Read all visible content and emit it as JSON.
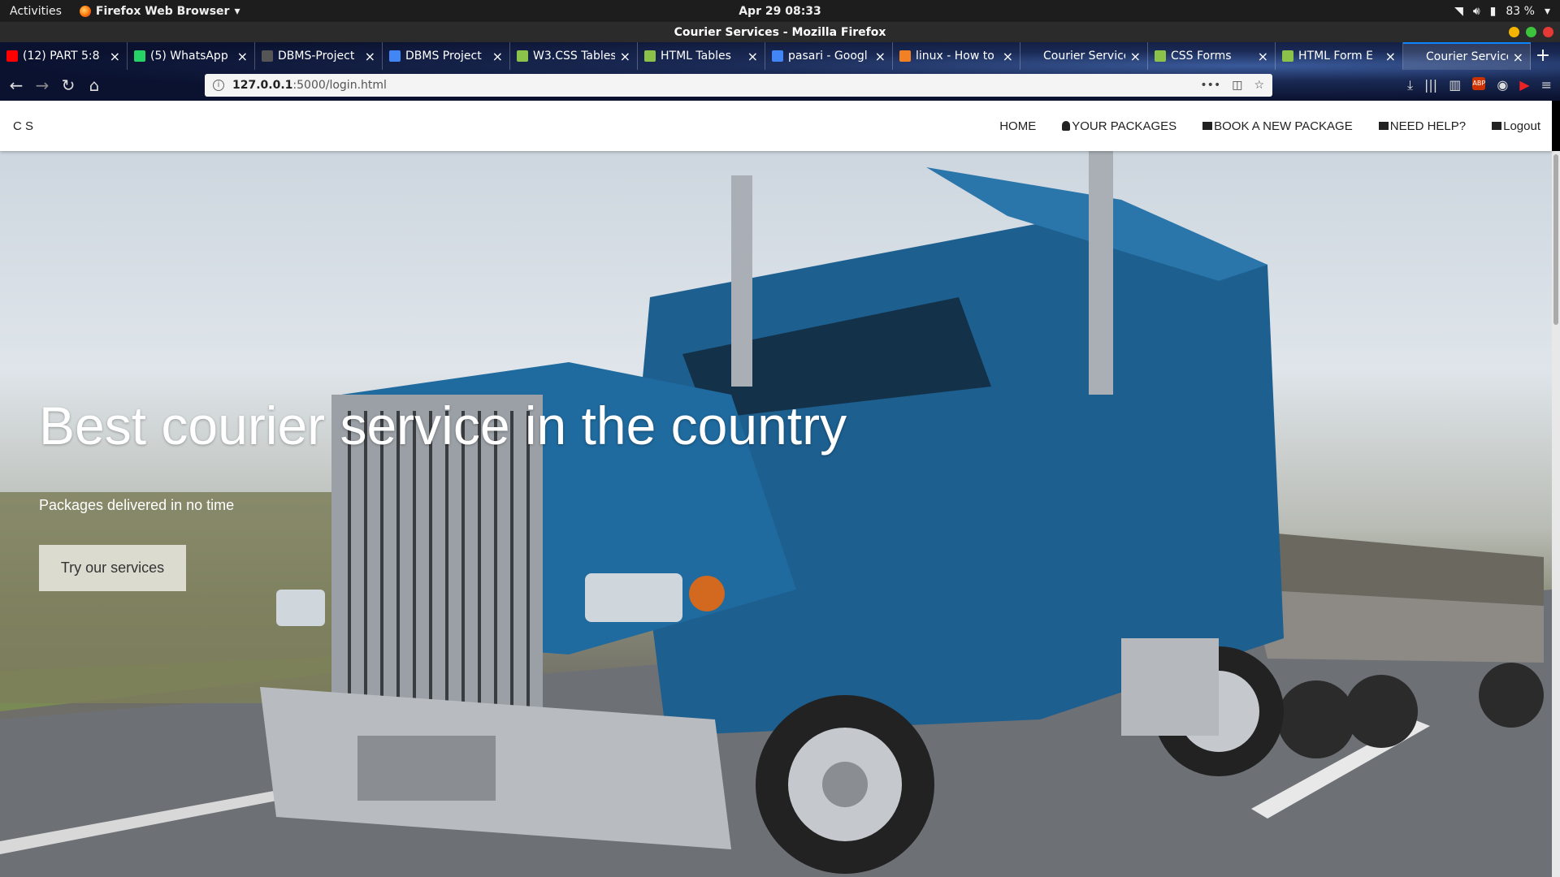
{
  "system": {
    "activities": "Activities",
    "app_menu": "Firefox Web Browser",
    "clock": "Apr 29  08:33",
    "battery": "83 %"
  },
  "window": {
    "title": "Courier Services - Mozilla Firefox"
  },
  "tabs": [
    {
      "label": "(12) PART 5:8",
      "favicon_color": "#ff0000"
    },
    {
      "label": "(5) WhatsApp",
      "favicon_color": "#25d366"
    },
    {
      "label": "DBMS-Project",
      "favicon_color": "#555555"
    },
    {
      "label": "DBMS Project",
      "favicon_color": "#4285f4"
    },
    {
      "label": "W3.CSS Tables",
      "favicon_color": "#8bc34a"
    },
    {
      "label": "HTML Tables",
      "favicon_color": "#8bc34a"
    },
    {
      "label": "pasari - Googl",
      "favicon_color": "#4285f4"
    },
    {
      "label": "linux - How to",
      "favicon_color": "#f48024"
    },
    {
      "label": "Courier Services",
      "favicon_color": "transparent"
    },
    {
      "label": "CSS Forms",
      "favicon_color": "#8bc34a"
    },
    {
      "label": "HTML Form E",
      "favicon_color": "#8bc34a"
    },
    {
      "label": "Courier Services",
      "favicon_color": "transparent",
      "active": true
    }
  ],
  "url": {
    "host": "127.0.0.1",
    "path": ":5000/login.html"
  },
  "toolbar": {
    "abp": "ABP"
  },
  "site": {
    "brand": "C S",
    "nav": {
      "home": "HOME",
      "packages": "YOUR PACKAGES",
      "book": "BOOK A NEW PACKAGE",
      "help": "NEED HELP?",
      "logout": "Logout"
    },
    "hero": {
      "title": "Best courier service in the country",
      "subtitle": "Packages delivered in no time",
      "cta": "Try our services"
    }
  }
}
